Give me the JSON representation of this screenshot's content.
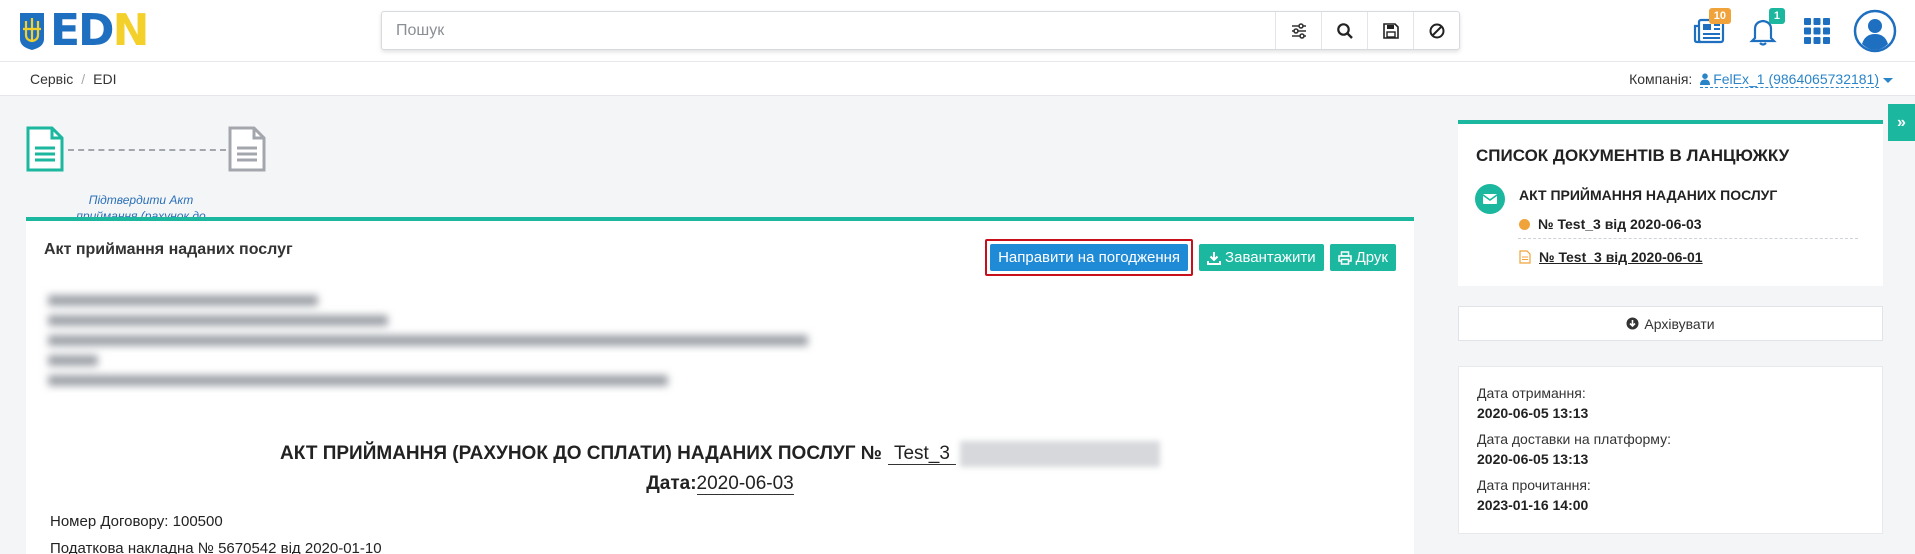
{
  "logo": {
    "letters_blue": "ED",
    "letter_n": "N"
  },
  "search": {
    "placeholder": "Пошук"
  },
  "header": {
    "badges": {
      "documents": "10",
      "notifications": "1"
    }
  },
  "breadcrumb": {
    "items": [
      "Сервіс",
      "EDI"
    ]
  },
  "company": {
    "label": "Компанія:",
    "value": "FelEx_1 (9864065732181)"
  },
  "chain_steps": {
    "current_label": "Підтвердити Акт приймання (рахунок до сплати) наданих послуг"
  },
  "document": {
    "title": "Акт приймання наданих послуг",
    "actions": {
      "send_approval": "Направити на погодження",
      "download": "Завантажити",
      "print": "Друк"
    },
    "heading": "АКТ ПРИЙМАННЯ (РАХУНОК ДО СПЛАТИ) НАДАНИХ ПОСЛУГ №",
    "number": "Test_3",
    "date_label": "Дата:",
    "date_value": "2020-06-03",
    "contract": "Номер Договору: 100500",
    "tax_invoice": "Податкова накладна № 5670542 від 2020-01-10"
  },
  "sidebar": {
    "chain_title": "СПИСОК ДОКУМЕНТІВ В ЛАНЦЮЖКУ",
    "chain_doc_type": "АКТ ПРИЙМАННЯ НАДАНИХ ПОСЛУГ",
    "chain_current": "№ Test_3 від 2020-06-03",
    "chain_related": "№ Test_3 від 2020-06-01",
    "archive_label": "Архівувати",
    "dates": {
      "received_label": "Дата отримання:",
      "received_value": "2020-06-05 13:13",
      "delivered_label": "Дата доставки на платформу:",
      "delivered_value": "2020-06-05 13:13",
      "read_label": "Дата прочитання:",
      "read_value": "2023-01-16 14:00"
    }
  },
  "colors": {
    "accent": "#1bb79f",
    "primary": "#1f8ad6",
    "highlight": "#c8101c",
    "warning": "#f0a33a"
  }
}
